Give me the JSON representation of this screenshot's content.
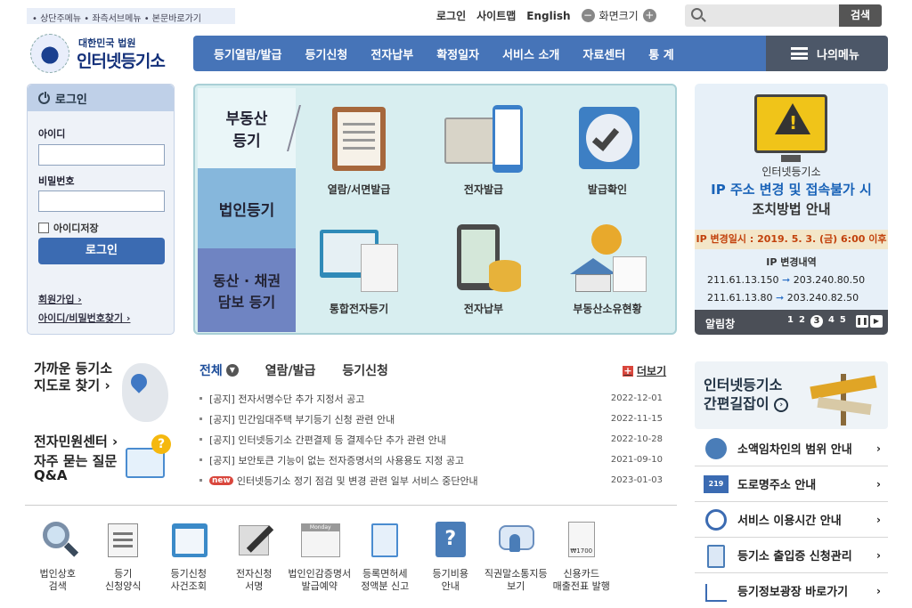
{
  "skip_links": "• 상단주메뉴 • 좌측서브메뉴 • 본문바로가기",
  "top_links": {
    "login": "로그인",
    "sitemap": "사이트맵",
    "english": "English",
    "zoom": "화면크기",
    "minus": "−",
    "plus": "+"
  },
  "search": {
    "placeholder": "",
    "button": "검색"
  },
  "logo": {
    "sub": "대한민국 법원",
    "main": "인터넷등기소"
  },
  "gnb": [
    "등기열람/발급",
    "등기신청",
    "전자납부",
    "확정일자",
    "서비스 소개",
    "자료센터",
    "통 계"
  ],
  "my_menu": "나의메뉴",
  "login": {
    "title": "로그인",
    "id_label": "아이디",
    "pw_label": "비밀번호",
    "remember": "아이디저장",
    "button": "로그인",
    "join": "회원가입 ›",
    "find": "아이디/비밀번호찾기 ›"
  },
  "categories": [
    "부동산\n등기",
    "법인등기",
    "동산 · 채권\n담보 등기"
  ],
  "tiles": [
    "열람/서면발급",
    "전자발급",
    "발급확인",
    "통합전자등기",
    "전자납부",
    "부동산소유현황"
  ],
  "banner": {
    "t1": "인터넷등기소",
    "t2": "IP 주소 변경 및 접속불가 시",
    "t3": "조치방법 안내",
    "date": "IP 변경일시 : 2019. 5. 3. (금) 6:00 이후",
    "t4": "IP 변경내역",
    "ip1_from": "211.61.13.150",
    "ip1_to": "203.240.80.50",
    "ip2_from": "211.61.13.80",
    "ip2_to": "203.240.82.50",
    "arrow": "➞",
    "bar_name": "알림창",
    "dots": [
      "1",
      "2",
      "3",
      "4",
      "5"
    ],
    "pause": "❚❚",
    "next": "▶"
  },
  "left_lower": {
    "near": "가까운 등기소\n지도로 찾기 ›",
    "civil": "전자민원센터 ›",
    "faq": "자주 묻는 질문\nQ&A",
    "q": "?"
  },
  "notice_tabs": {
    "all": "전체",
    "tab2": "열람/발급",
    "tab3": "등기신청",
    "more": "더보기",
    "plus": "+",
    "down": "▼"
  },
  "notices": [
    {
      "title": "[공지] 전자서명수단 추가 지정서 공고",
      "date": "2022-12-01"
    },
    {
      "title": "[공지] 민간임대주택 부기등기 신청 관련 안내",
      "date": "2022-11-15"
    },
    {
      "title": "[공지] 인터넷등기소 간편결제 등 결제수단 추가 관련 안내",
      "date": "2022-10-28"
    },
    {
      "title": "[공지] 보안토큰 기능이 없는 전자증명서의 사용용도 지정 공고",
      "date": "2021-09-10"
    },
    {
      "title": "인터넷등기소 정기 점검 및 변경 관련 일부 서비스 중단안내",
      "date": "2023-01-03",
      "badge": "new"
    }
  ],
  "quick": [
    "법인상호\n검색",
    "등기\n신청양식",
    "등기신청\n사건조회",
    "전자신청\n서명",
    "법인인감증명서\n발급예약",
    "등록면허세\n정액분 신고",
    "등기비용\n안내",
    "직권말소통지등\n보기",
    "신용카드\n매출전표 발행"
  ],
  "quick_icon_text": {
    "monday": "Monday",
    "price": "₩1700"
  },
  "easy": {
    "title": "인터넷등기소\n간편길잡이",
    "go": "›"
  },
  "services": [
    "소액임차인의 범위 안내",
    "도로명주소 안내",
    "서비스 이용시간 안내",
    "등기소 출입증 신청관리",
    "등기정보광장 바로가기"
  ],
  "service_icon_text": {
    "road_no": "219"
  },
  "colors": {
    "nav": "#4674b8",
    "accent_blue": "#1a63b8",
    "warn": "#f0c419",
    "new_badge": "#d9463c"
  }
}
